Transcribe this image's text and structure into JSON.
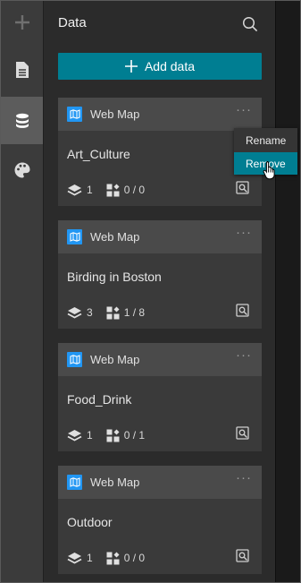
{
  "panel": {
    "title": "Data",
    "add_button_label": "Add data"
  },
  "rail": {
    "items": [
      {
        "icon": "plus-icon"
      },
      {
        "icon": "page-icon"
      },
      {
        "icon": "database-icon",
        "active": true
      },
      {
        "icon": "palette-icon"
      }
    ]
  },
  "cards": [
    {
      "type": "Web Map",
      "title": "Art_Culture",
      "layers": "1",
      "widgets": "0 / 0"
    },
    {
      "type": "Web Map",
      "title": "Birding in Boston",
      "layers": "3",
      "widgets": "1 / 8"
    },
    {
      "type": "Web Map",
      "title": "Food_Drink",
      "layers": "1",
      "widgets": "0 / 1"
    },
    {
      "type": "Web Map",
      "title": "Outdoor",
      "layers": "1",
      "widgets": "0 / 0"
    }
  ],
  "menu": {
    "rename_label": "Rename",
    "remove_label": "Remove"
  },
  "colors": {
    "accent": "#007e92",
    "webmap_icon": "#2196f3"
  }
}
